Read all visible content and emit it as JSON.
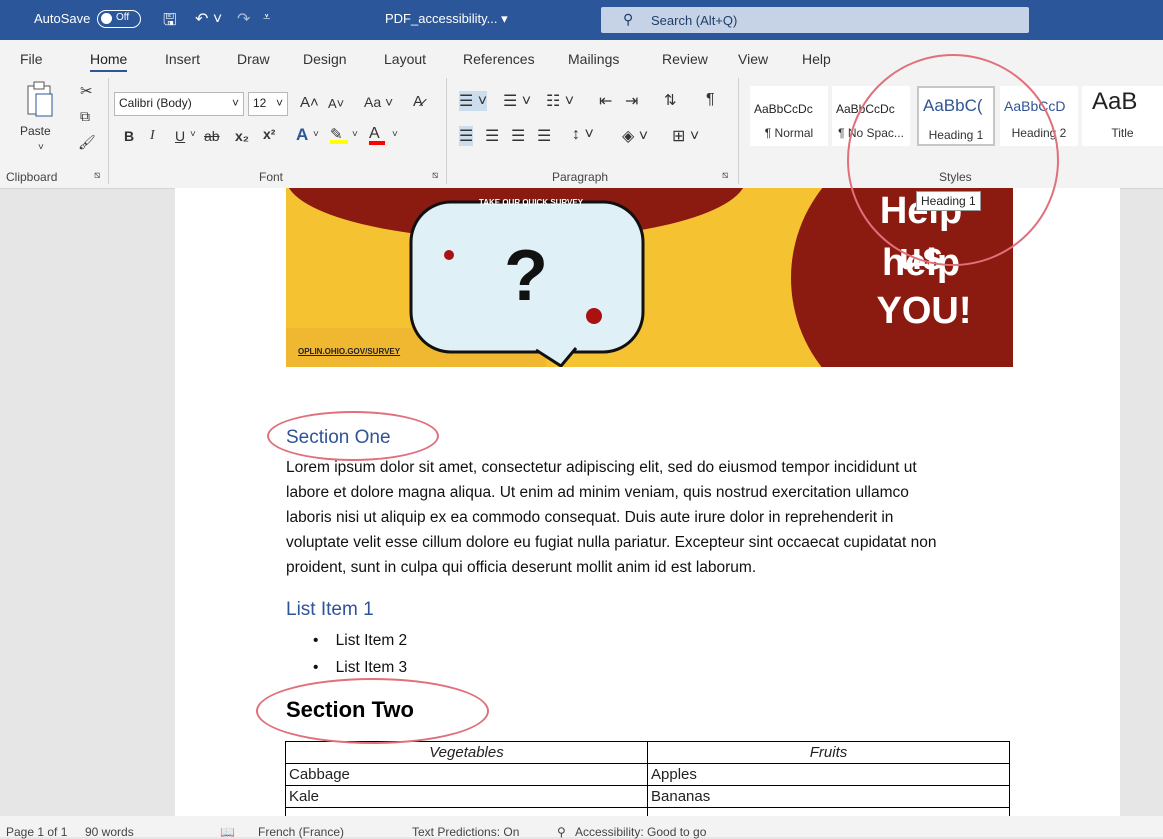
{
  "titlebar": {
    "autosave_label": "AutoSave",
    "autosave_state": "Off",
    "doc_title": "PDF_accessibility...",
    "search_placeholder": "Search (Alt+Q)"
  },
  "menu": [
    "File",
    "Home",
    "Insert",
    "Draw",
    "Design",
    "Layout",
    "References",
    "Mailings",
    "Review",
    "View",
    "Help"
  ],
  "ribbon": {
    "clipboard": {
      "paste_label": "Paste",
      "group_label": "Clipboard"
    },
    "font": {
      "font_name": "Calibri (Body)",
      "font_size": "12",
      "group_label": "Font",
      "bold": "B",
      "italic": "I",
      "underline": "U",
      "strike": "ab",
      "subscript": "x₂",
      "superscript": "x²",
      "grow": "A",
      "shrink": "A",
      "case": "Aa",
      "highlight_color": "#ffff00",
      "font_color": "#ff0000"
    },
    "paragraph": {
      "group_label": "Paragraph",
      "pilcrow": "¶"
    },
    "styles": {
      "group_label": "Styles",
      "items": [
        {
          "sample": "AaBbCcDc",
          "name": "¶ Normal"
        },
        {
          "sample": "AaBbCcDc",
          "name": "¶ No Spac..."
        },
        {
          "sample": "AaBbC(",
          "name": "Heading 1"
        },
        {
          "sample": "AaBbCcD",
          "name": "Heading 2"
        },
        {
          "sample": "AaB",
          "name": "Title"
        }
      ],
      "tooltip": "Heading 1"
    }
  },
  "document": {
    "banner": {
      "survey_text": "TAKE OUR QUICK SURVEY",
      "url": "OPLIN.OHIO.GOV/SURVEY",
      "line1": "Help us",
      "line2": "help",
      "line3": "YOU!"
    },
    "section_one": "Section One",
    "paragraph_lines": [
      "Lorem ipsum dolor sit amet, consectetur adipiscing elit, sed do eiusmod tempor incididunt ut",
      "labore et dolore magna aliqua. Ut enim ad minim veniam, quis nostrud exercitation ullamco",
      "laboris nisi ut aliquip ex ea commodo consequat. Duis aute irure dolor in reprehenderit in",
      "voluptate velit esse cillum dolore eu fugiat nulla pariatur. Excepteur sint occaecat cupidatat non",
      "proident, sunt in culpa qui officia deserunt mollit anim id est laborum."
    ],
    "list_heading": "List Item 1",
    "list_items": [
      "List Item 2",
      "List Item 3"
    ],
    "section_two": "Section Two",
    "table": {
      "headers": [
        "Vegetables",
        "Fruits"
      ],
      "rows": [
        [
          "Cabbage",
          "Apples"
        ],
        [
          "Kale",
          "Bananas"
        ]
      ]
    }
  },
  "statusbar": {
    "page": "Page 1 of 1",
    "words": "90 words",
    "language": "French (France)",
    "predictions": "Text Predictions: On",
    "accessibility": "Accessibility: Good to go"
  },
  "colors": {
    "accent": "#2b579a",
    "heading_blue": "#2f5496",
    "annotation_circle": "#e0707c",
    "banner_yellow": "#f5c232",
    "banner_red": "#8b1a10"
  }
}
